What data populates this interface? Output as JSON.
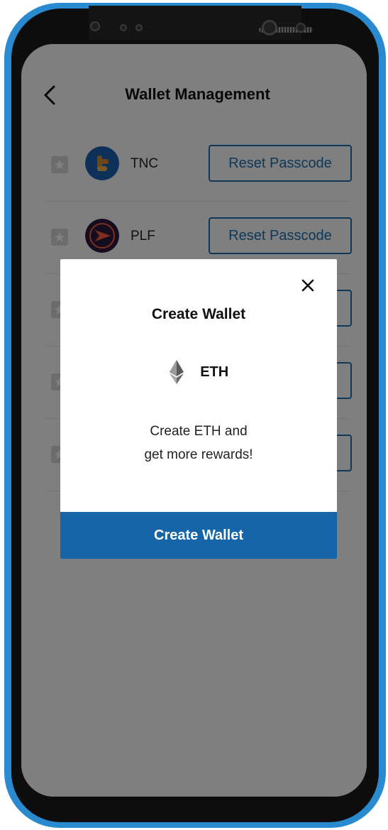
{
  "header": {
    "title": "Wallet Management"
  },
  "wallets": [
    {
      "name": "TNC",
      "action": "Reset Passcode",
      "logo_color": "#1d63b3",
      "logo_accent": "#e08a2a"
    },
    {
      "name": "PLF",
      "action": "Reset Passcode",
      "logo_color": "#2a1b3d",
      "logo_accent": "#ff5a3c"
    },
    {
      "name": "",
      "action": ""
    },
    {
      "name": "",
      "action": ""
    },
    {
      "name": "",
      "action": ""
    }
  ],
  "modal": {
    "title": "Create Wallet",
    "coin": "ETH",
    "description_line1": "Create ETH and",
    "description_line2": "get more rewards!",
    "button_label": "Create Wallet"
  },
  "colors": {
    "accent": "#1565a8",
    "frame": "#2a8ad0",
    "overlay": "rgba(0,0,0,0.50)"
  },
  "icons": {
    "back": "chevron-left-icon",
    "close": "close-icon",
    "favorite": "star-icon",
    "coin": "ethereum-icon"
  }
}
